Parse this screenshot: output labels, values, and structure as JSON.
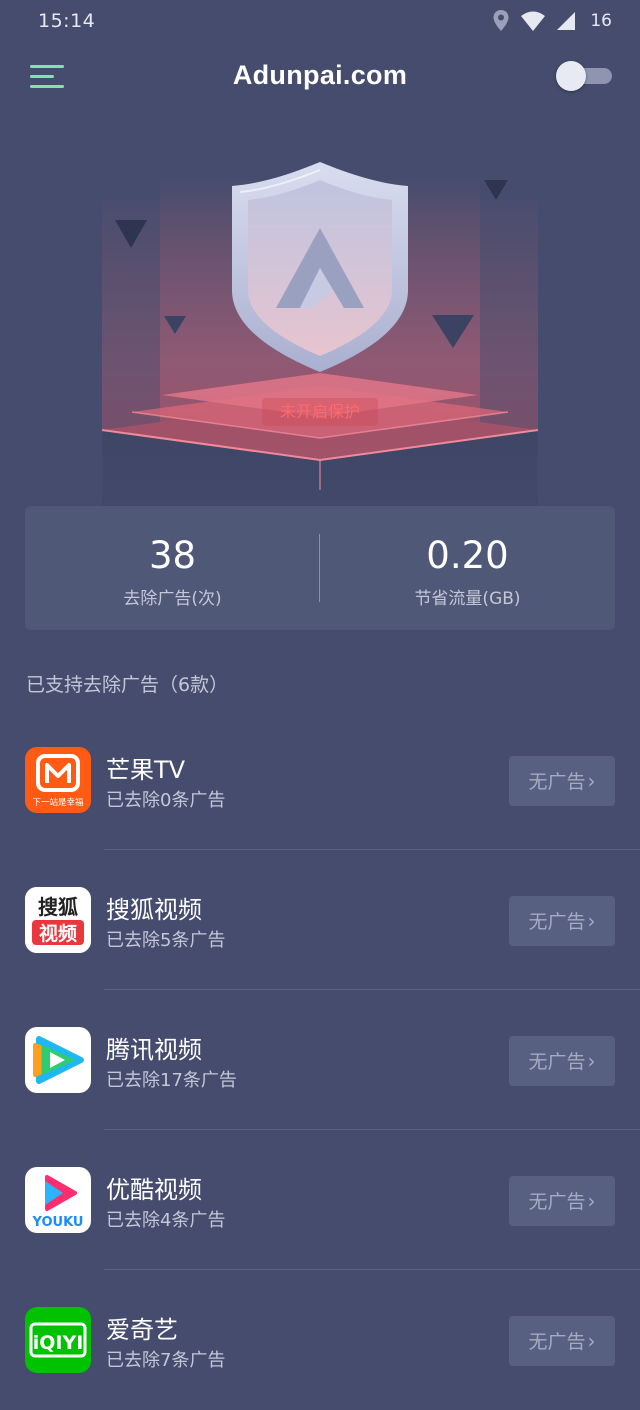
{
  "status_bar": {
    "time": "15:14",
    "battery": "16",
    "icons": [
      "location-icon",
      "wifi-icon",
      "signal-icon"
    ]
  },
  "header": {
    "brand": "Adunpai.com",
    "protection_toggle": "off"
  },
  "hero": {
    "status_text": "未开启保护"
  },
  "stats": {
    "ads_removed_value": "38",
    "ads_removed_label": "去除广告(次)",
    "data_saved_value": "0.20",
    "data_saved_label": "节省流量(GB)"
  },
  "section": {
    "title": "已支持去除广告（6款）"
  },
  "apps": [
    {
      "name": "芒果TV",
      "sub": "已去除0条广告",
      "button": "无广告",
      "icon": "mango-tv-icon",
      "icon_text": "下一站是幸福"
    },
    {
      "name": "搜狐视频",
      "sub": "已去除5条广告",
      "button": "无广告",
      "icon": "sohu-video-icon",
      "icon_top": "搜狐",
      "icon_bottom": "视频"
    },
    {
      "name": "腾讯视频",
      "sub": "已去除17条广告",
      "button": "无广告",
      "icon": "tencent-video-icon"
    },
    {
      "name": "优酷视频",
      "sub": "已去除4条广告",
      "button": "无广告",
      "icon": "youku-icon",
      "icon_text": "YOUKU"
    },
    {
      "name": "爱奇艺",
      "sub": "已去除7条广告",
      "button": "无广告",
      "icon": "iqiyi-icon",
      "icon_text": "iQIYI"
    }
  ],
  "colors": {
    "background": "#454c6d",
    "card": "#505878",
    "menu_accent": "#7fe3b2",
    "warning_text": "#ff6a6a"
  }
}
